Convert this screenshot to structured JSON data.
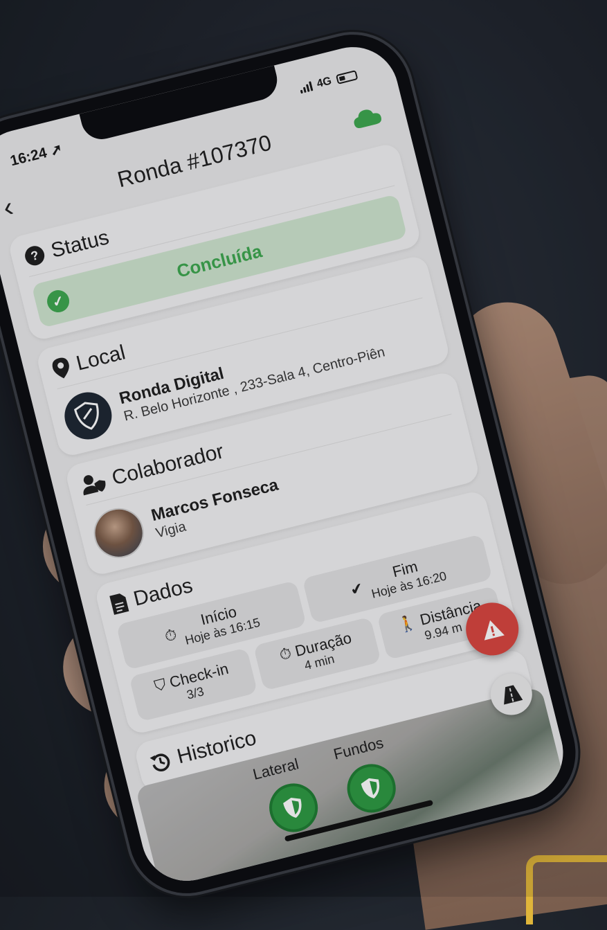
{
  "status_bar": {
    "time": "16:24",
    "network": "4G"
  },
  "header": {
    "title": "Ronda #107370",
    "back_icon": "chevron-left-icon",
    "sync_icon": "cloud-icon"
  },
  "status": {
    "label": "Status",
    "value": "Concluída",
    "color": "#3ea84f"
  },
  "local": {
    "label": "Local",
    "name": "Ronda Digital",
    "address": "R. Belo Horizonte , 233-Sala 4, Centro-Piên"
  },
  "colaborador": {
    "label": "Colaborador",
    "name": "Marcos Fonseca",
    "role": "Vigia"
  },
  "dados": {
    "label": "Dados",
    "inicio": {
      "label": "Início",
      "value": "Hoje às 16:15"
    },
    "fim": {
      "label": "Fim",
      "value": "Hoje às 16:20"
    },
    "checkin": {
      "label": "Check-in",
      "value": "3/3"
    },
    "duracao": {
      "label": "Duração",
      "value": "4 min"
    },
    "distancia": {
      "label": "Distância",
      "value": "9.94 m"
    }
  },
  "historico": {
    "label": "Historico",
    "markers": [
      "Lateral",
      "Fundos"
    ]
  },
  "colors": {
    "accent_green": "#3ea84f",
    "alert_red": "#d9463f",
    "dark_navy": "#1e2733"
  }
}
